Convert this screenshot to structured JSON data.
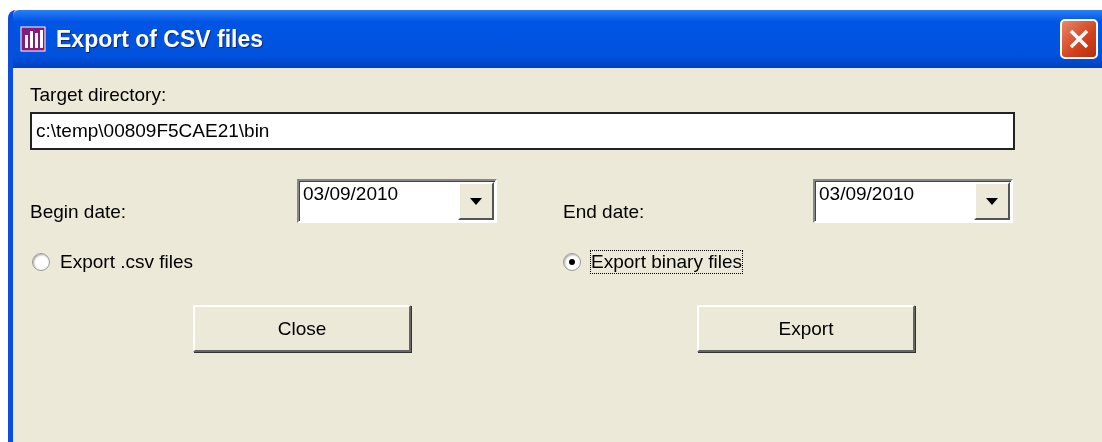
{
  "window": {
    "title": "Export of CSV files"
  },
  "target": {
    "label": "Target directory:",
    "value": "c:\\temp\\00809F5CAE21\\bin"
  },
  "dates": [
    {
      "label": "Begin date:",
      "value": "03/09/2010"
    },
    {
      "label": "End date:",
      "value": "03/09/2010"
    }
  ],
  "options": [
    {
      "label": "Export .csv files",
      "selected": false,
      "focused": false
    },
    {
      "label": "Export binary files",
      "selected": true,
      "focused": true
    }
  ],
  "buttons": [
    "Close",
    "Export"
  ]
}
